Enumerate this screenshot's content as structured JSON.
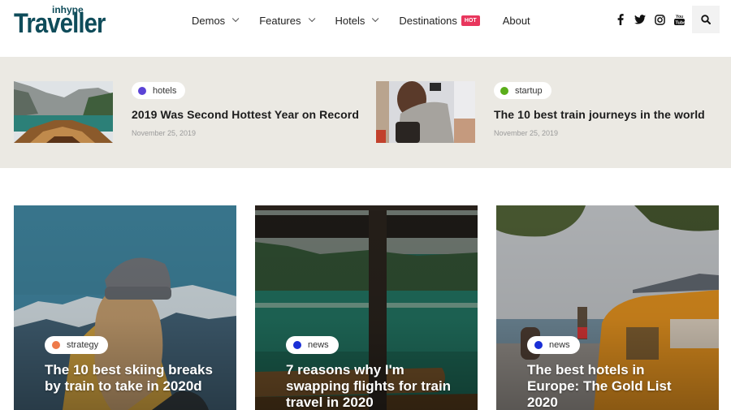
{
  "logo": {
    "small": "inhype",
    "big": "Traveller"
  },
  "nav": {
    "items": [
      {
        "label": "Demos",
        "has_dropdown": true
      },
      {
        "label": "Features",
        "has_dropdown": true
      },
      {
        "label": "Hotels",
        "has_dropdown": true
      },
      {
        "label": "Destinations",
        "has_dropdown": false,
        "badge": "HOT"
      },
      {
        "label": "About",
        "has_dropdown": false
      }
    ]
  },
  "social": [
    {
      "icon": "facebook-icon",
      "glyph": "f"
    },
    {
      "icon": "twitter-icon",
      "glyph": "t"
    },
    {
      "icon": "instagram-icon",
      "glyph": "ig"
    },
    {
      "icon": "youtube-icon",
      "glyph": "yt"
    }
  ],
  "colors": {
    "brand": "#0f4c5a",
    "hot_badge": "#e8365d",
    "strip_bg": "#ebe9e3",
    "hotels": "#5b43d6",
    "startup": "#5aad1a",
    "strategy": "#ee7a4a",
    "news": "#1a2fd6"
  },
  "featured": [
    {
      "category": "hotels",
      "title": "2019 Was Second Hottest Year on Record",
      "date": "November 25, 2019"
    },
    {
      "category": "startup",
      "title": "The 10 best train journeys in the world",
      "date": "November 25, 2019"
    }
  ],
  "cards": [
    {
      "category": "strategy",
      "title": "The 10 best skiing breaks by train to take in 2020d"
    },
    {
      "category": "news",
      "title": "7 reasons why I'm swapping flights for train travel in 2020"
    },
    {
      "category": "news",
      "title": "The best hotels in Europe: The Gold List 2020"
    }
  ]
}
